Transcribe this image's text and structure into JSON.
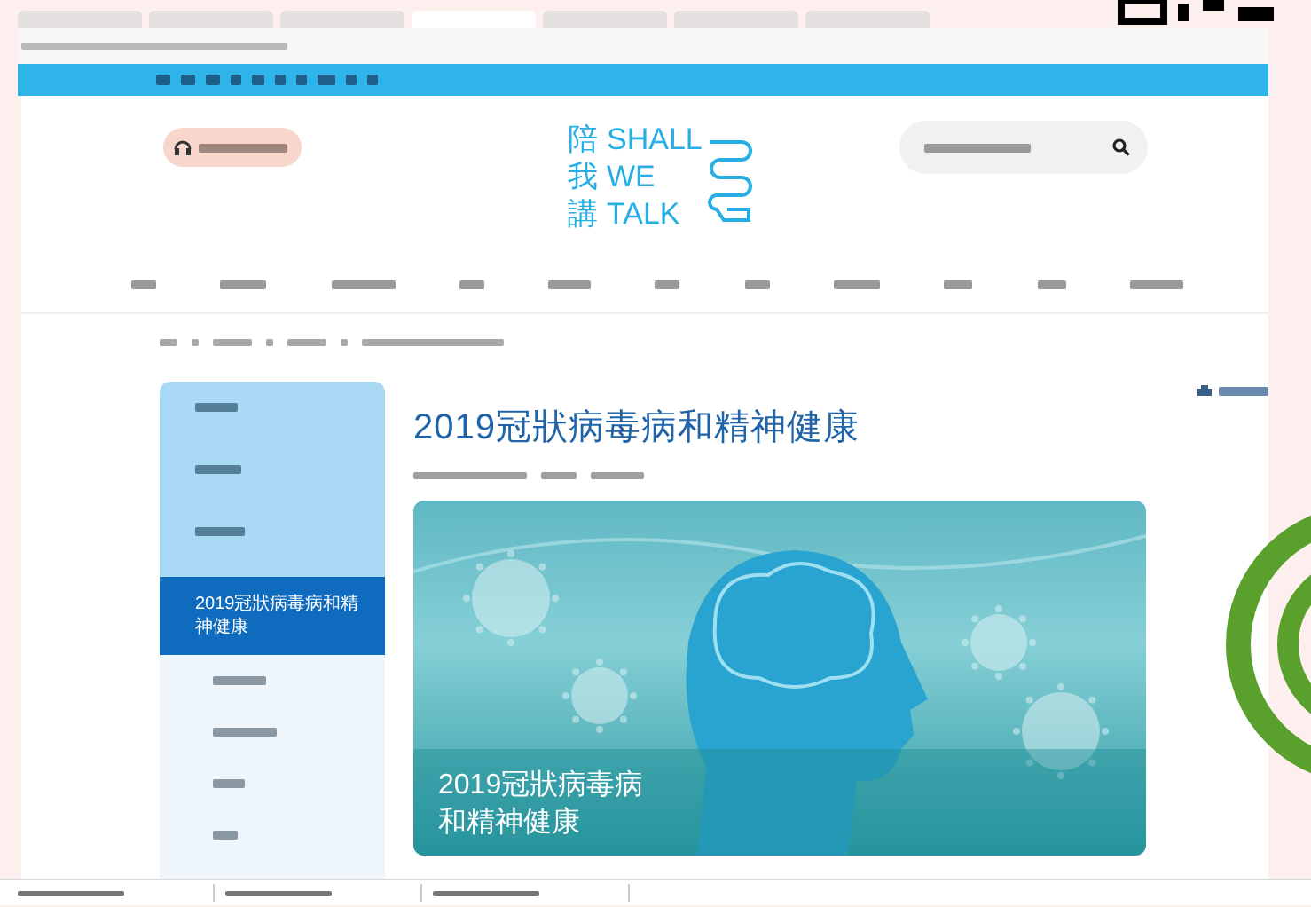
{
  "browser_tabs": [
    {
      "selected": false
    },
    {
      "selected": false
    },
    {
      "selected": false
    },
    {
      "selected": true
    },
    {
      "selected": false
    },
    {
      "selected": false
    },
    {
      "selected": false
    }
  ],
  "logo": {
    "lines": [
      {
        "zh": "陪",
        "en": "SHALL"
      },
      {
        "zh": "我",
        "en": "WE"
      },
      {
        "zh": "講",
        "en": "TALK"
      }
    ]
  },
  "sidebar": {
    "current_item": "2019冠狀病毒病和精神健康"
  },
  "article": {
    "title": "2019冠狀病毒病和精神健康",
    "banner_caption": [
      "2019冠狀病毒病",
      "和精神健康"
    ]
  }
}
